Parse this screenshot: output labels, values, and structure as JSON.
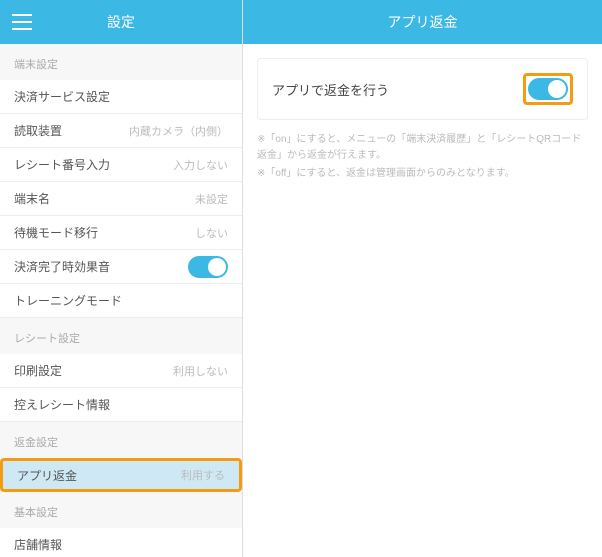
{
  "left": {
    "title": "設定",
    "sections": [
      {
        "header": "端末設定",
        "items": [
          {
            "label": "決済サービス設定",
            "value": ""
          },
          {
            "label": "読取装置",
            "value": "内蔵カメラ（内側）"
          },
          {
            "label": "レシート番号入力",
            "value": "入力しない"
          },
          {
            "label": "端末名",
            "value": "未設定"
          },
          {
            "label": "待機モード移行",
            "value": "しない"
          },
          {
            "label": "決済完了時効果音",
            "toggle": true,
            "on": true
          },
          {
            "label": "トレーニングモード",
            "value": ""
          }
        ]
      },
      {
        "header": "レシート設定",
        "items": [
          {
            "label": "印刷設定",
            "value": "利用しない"
          },
          {
            "label": "控えレシート情報",
            "value": ""
          }
        ]
      },
      {
        "header": "返金設定",
        "items": [
          {
            "label": "アプリ返金",
            "value": "利用する",
            "selected": true,
            "highlight": true
          }
        ]
      },
      {
        "header": "基本設定",
        "items": [
          {
            "label": "店舗情報",
            "value": ""
          }
        ]
      }
    ]
  },
  "right": {
    "title": "アプリ返金",
    "card_label": "アプリで返金を行う",
    "toggle_on": true,
    "toggle_highlight": true,
    "hint1": "※「on」にすると、メニューの「端末決済履歴」と「レシートQRコード返金」から返金が行えます。",
    "hint2": "※「off」にすると、返金は管理画面からのみとなります。"
  }
}
